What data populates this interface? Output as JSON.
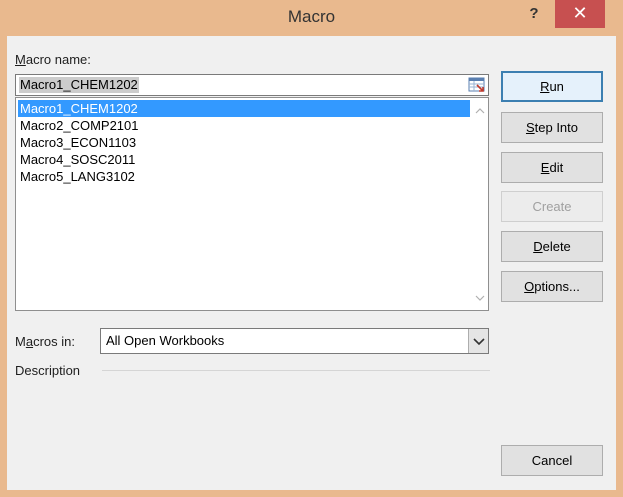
{
  "window": {
    "title": "Macro",
    "help_label": "?",
    "close_label": "✕"
  },
  "macro_name": {
    "label_mnemonic": "M",
    "label_rest": "acro name:",
    "value": "Macro1_CHEM1202"
  },
  "macros": [
    {
      "name": "Macro1_CHEM1202",
      "selected": true
    },
    {
      "name": "Macro2_COMP2101",
      "selected": false
    },
    {
      "name": "Macro3_ECON1103",
      "selected": false
    },
    {
      "name": "Macro4_SOSC2011",
      "selected": false
    },
    {
      "name": "Macro5_LANG3102",
      "selected": false
    }
  ],
  "buttons": {
    "run": {
      "mnemonic": "R",
      "rest": "un"
    },
    "step_into": {
      "mnemonic": "S",
      "rest": "tep Into"
    },
    "edit": {
      "mnemonic": "E",
      "rest": "dit"
    },
    "create": {
      "label": "Create"
    },
    "delete": {
      "mnemonic": "D",
      "rest": "elete"
    },
    "options": {
      "mnemonic": "O",
      "rest": "ptions..."
    },
    "cancel": {
      "label": "Cancel"
    }
  },
  "macros_in": {
    "label_a": "M",
    "label_mnemonic": "a",
    "label_rest": "cros in:",
    "value": "All Open Workbooks"
  },
  "description": {
    "label": "Description"
  },
  "icons": [
    "refedit-icon",
    "scroll-up-icon",
    "scroll-down-icon",
    "dropdown-arrow-icon"
  ],
  "colors": {
    "titlebar": "#e9b98e",
    "close": "#c75050",
    "selection": "#3399ff"
  }
}
